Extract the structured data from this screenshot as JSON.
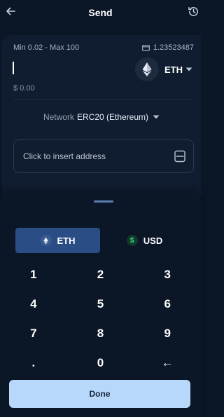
{
  "header": {
    "title": "Send",
    "back_icon": "arrow-left-icon",
    "history_icon": "history-icon"
  },
  "amount": {
    "limits": "Min 0.02 - Max 100",
    "balance": "1.23523487",
    "fiat_equivalent": "$ 0.00",
    "coin": "ETH"
  },
  "network": {
    "label": "Network",
    "value": "ERC20 (Ethereum)"
  },
  "address": {
    "placeholder": "Click to insert address"
  },
  "toggle": {
    "crypto_label": "ETH",
    "usd_symbol": "$",
    "fiat_label": "USD",
    "active": "ETH"
  },
  "keypad": {
    "rows": [
      [
        "1",
        "2",
        "3"
      ],
      [
        "4",
        "5",
        "6"
      ],
      [
        "7",
        "8",
        "9"
      ],
      [
        ".",
        "0",
        "←"
      ]
    ]
  },
  "done_label": "Done",
  "colors": {
    "background": "#0b1626",
    "card": "#101d30",
    "active_toggle": "#2a4d86",
    "done_button": "#b7d8fb",
    "usd_green": "#3ddc84"
  }
}
